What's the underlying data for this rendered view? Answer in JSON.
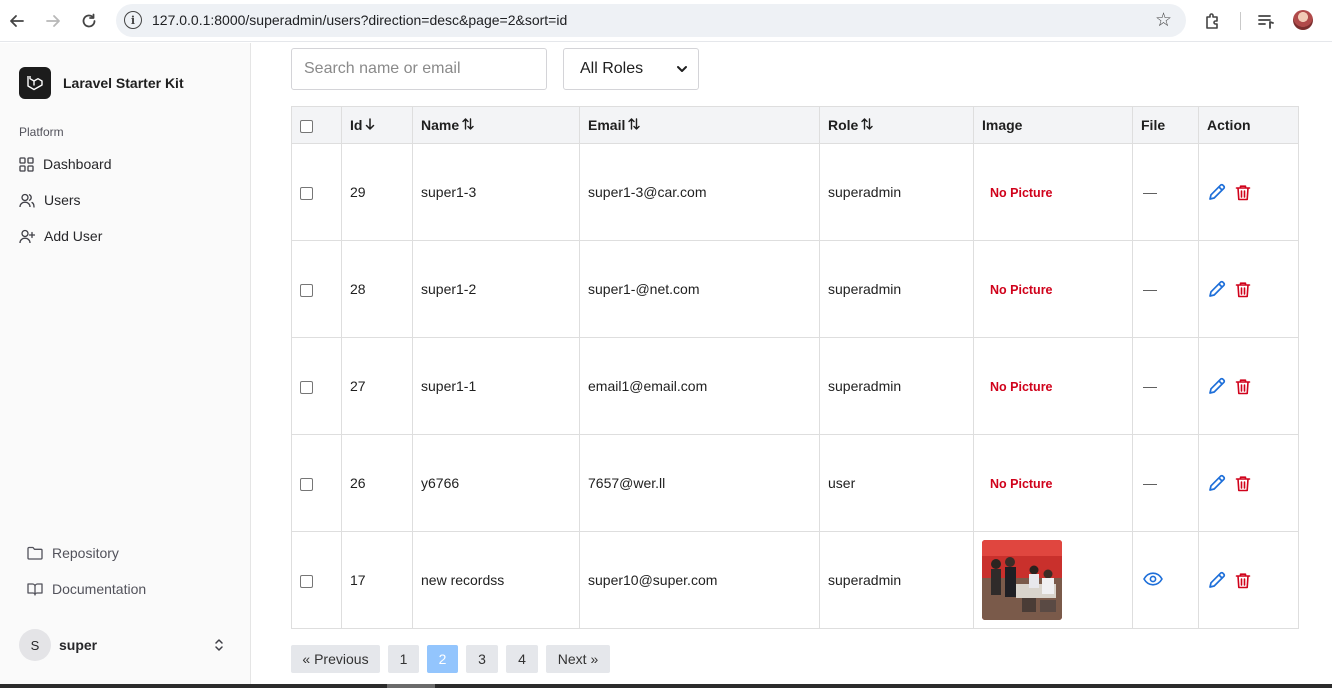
{
  "browser": {
    "url": "127.0.0.1:8000/superadmin/users?direction=desc&page=2&sort=id"
  },
  "sidebar": {
    "brand": "Laravel Starter Kit",
    "group_label": "Platform",
    "items": [
      {
        "label": "Dashboard"
      },
      {
        "label": "Users"
      },
      {
        "label": "Add User"
      }
    ],
    "footer_items": [
      {
        "label": "Repository"
      },
      {
        "label": "Documentation"
      }
    ],
    "user": {
      "initial": "S",
      "name": "super"
    }
  },
  "filters": {
    "search_placeholder": "Search name or email",
    "role_selected": "All Roles"
  },
  "table": {
    "headers": {
      "id": "Id",
      "name": "Name",
      "email": "Email",
      "role": "Role",
      "image": "Image",
      "file": "File",
      "action": "Action"
    },
    "sort": {
      "column": "id",
      "direction": "desc"
    },
    "rows": [
      {
        "id": "29",
        "name": "super1-3",
        "email": "super1-3@car.com",
        "role": "superadmin",
        "image": "No Picture",
        "file": "—"
      },
      {
        "id": "28",
        "name": "super1-2",
        "email": "super1-@net.com",
        "role": "superadmin",
        "image": "No Picture",
        "file": "—"
      },
      {
        "id": "27",
        "name": "super1-1",
        "email": "email1@email.com",
        "role": "superadmin",
        "image": "No Picture",
        "file": "—"
      },
      {
        "id": "26",
        "name": "y6766",
        "email": "7657@wer.ll",
        "role": "user",
        "image": "No Picture",
        "file": "—"
      },
      {
        "id": "17",
        "name": "new recordss",
        "email": "super10@super.com",
        "role": "superadmin",
        "image": "",
        "file": ""
      }
    ]
  },
  "pagination": {
    "previous": "« Previous",
    "pages": [
      "1",
      "2",
      "3",
      "4"
    ],
    "current": "2",
    "next": "Next »"
  },
  "colors": {
    "accent_blue": "#1e6fd9",
    "danger_red": "#d0021b",
    "active_page": "#93c5fd"
  }
}
